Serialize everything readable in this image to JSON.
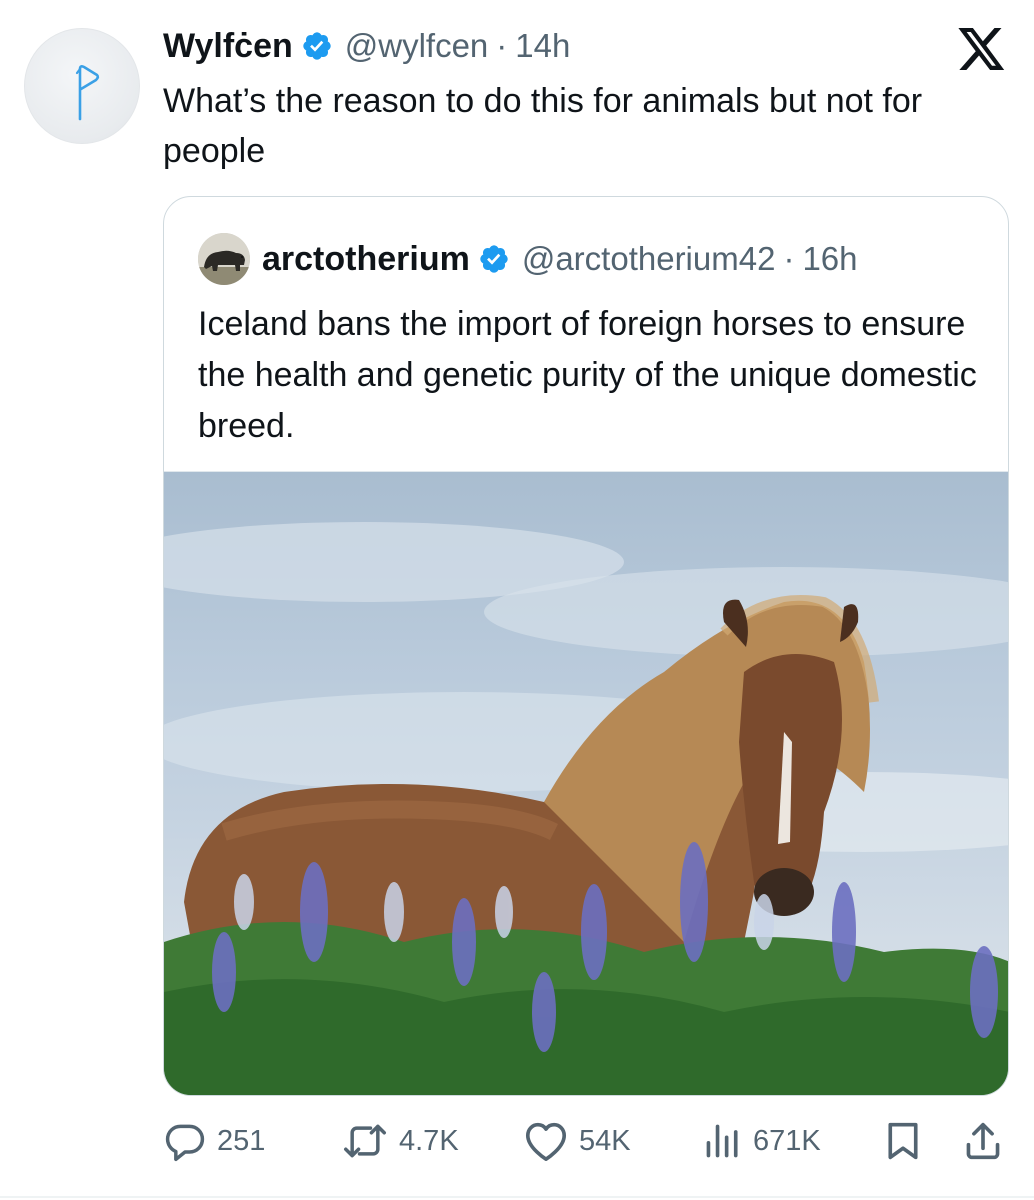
{
  "tweet": {
    "display_name": "Wylfċen",
    "handle": "@wylfcen",
    "separator": "·",
    "time": "14h",
    "text": "What’s the reason to do this for animals but not for people",
    "avatar_icon": "rune-wynn-icon",
    "verified_color": "#1d9bf0"
  },
  "quote": {
    "display_name": "arctotherium",
    "handle": "@arctotherium42",
    "separator": "·",
    "time": "16h",
    "text": "Iceland bans the import of foreign horses to ensure the health and genetic purity of the unique domestic breed.",
    "avatar_icon": "bear-avatar",
    "image_icon": "icelandic-horse-photo"
  },
  "actions": {
    "replies": "251",
    "reposts": "4.7K",
    "likes": "54K",
    "views": "671K"
  },
  "colors": {
    "text_primary": "#0f1419",
    "text_secondary": "#536471",
    "border": "#cfd9de"
  }
}
